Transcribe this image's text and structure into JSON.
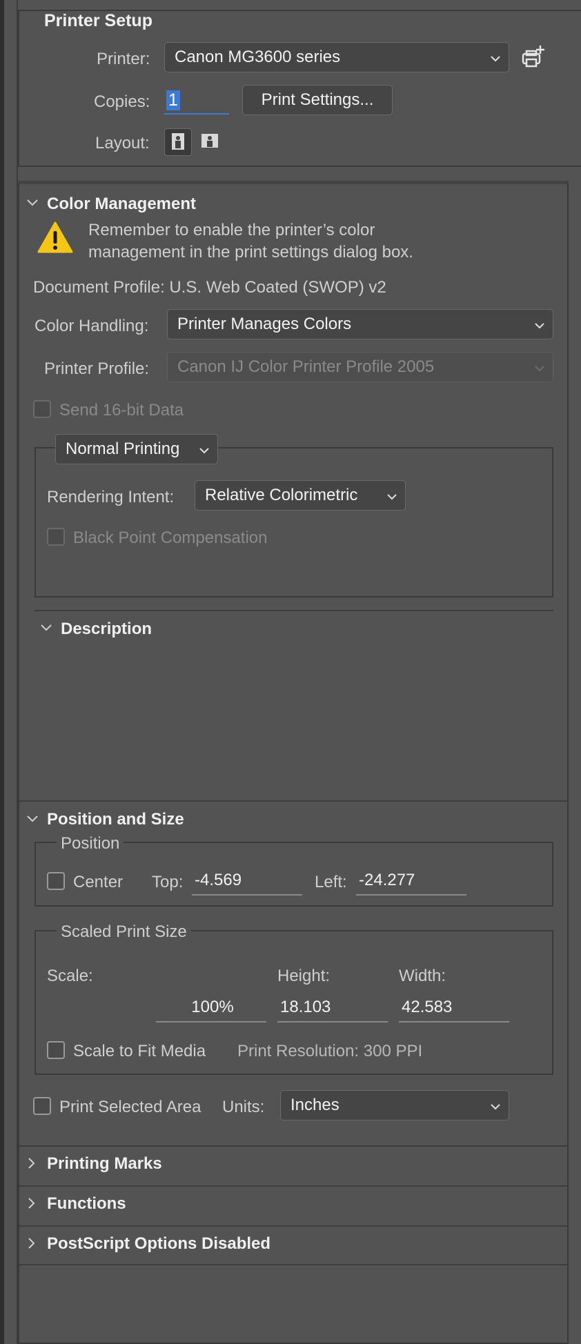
{
  "printer_setup": {
    "title": "Printer Setup",
    "printer_label": "Printer:",
    "printer_value": "Canon MG3600 series",
    "copies_label": "Copies:",
    "copies_value": "1",
    "print_settings_button": "Print Settings...",
    "layout_label": "Layout:"
  },
  "color_management": {
    "title": "Color Management",
    "warning_line1": "Remember to enable the printer’s color",
    "warning_line2": "management in the print settings dialog box.",
    "document_profile": "Document Profile: U.S. Web Coated (SWOP) v2",
    "color_handling_label": "Color Handling:",
    "color_handling_value": "Printer Manages Colors",
    "printer_profile_label": "Printer Profile:",
    "printer_profile_value": "Canon IJ Color Printer Profile 2005",
    "send16_label": "Send 16-bit Data",
    "send16_checked": false,
    "printing_mode_value": "Normal Printing",
    "rendering_intent_label": "Rendering Intent:",
    "rendering_intent_value": "Relative Colorimetric",
    "black_point_label": "Black Point Compensation",
    "black_point_checked": false
  },
  "description": {
    "title": "Description"
  },
  "position_size": {
    "title": "Position and Size",
    "position_group": "Position",
    "center_label": "Center",
    "center_checked": false,
    "top_label": "Top:",
    "top_value": "-4.569",
    "left_label": "Left:",
    "left_value": "-24.277",
    "scaled_group": "Scaled Print Size",
    "scale_label": "Scale:",
    "scale_value": "100%",
    "height_label": "Height:",
    "height_value": "18.103",
    "width_label": "Width:",
    "width_value": "42.583",
    "scale_fit_label": "Scale to Fit Media",
    "scale_fit_checked": false,
    "print_resolution": "Print Resolution: 300 PPI",
    "print_selected_label": "Print Selected Area",
    "print_selected_checked": false,
    "units_label": "Units:",
    "units_value": "Inches"
  },
  "sections": {
    "printing_marks": "Printing Marks",
    "functions": "Functions",
    "postscript": "PostScript Options Disabled"
  },
  "colors": {
    "background": "#535353",
    "accent": "#3d7ad6",
    "warning": "#f5c518"
  }
}
